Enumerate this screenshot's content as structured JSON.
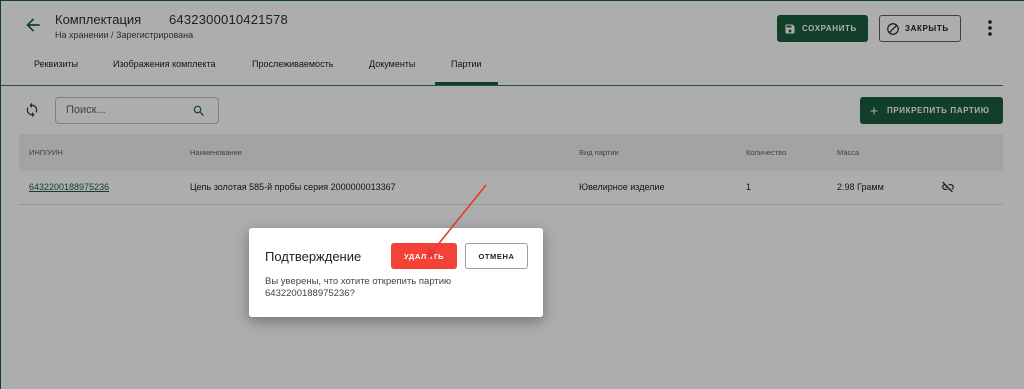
{
  "header": {
    "title": "Комплектация",
    "doc_number": "6432300010421578",
    "subtitle": "На хранении / Зарегистрирована",
    "save_label": "СОХРАНИТЬ",
    "close_label": "ЗАКРЫТЬ"
  },
  "tabs": [
    {
      "label": "Реквизиты"
    },
    {
      "label": "Изображения комплекта"
    },
    {
      "label": "Прослеживаемость"
    },
    {
      "label": "Документы"
    },
    {
      "label": "Партии",
      "active": true
    }
  ],
  "toolbar": {
    "search_placeholder": "Поиск...",
    "attach_label": "ПРИКРЕПИТЬ ПАРТИЮ"
  },
  "table": {
    "columns": [
      "ИНП/УИН",
      "Наименование",
      "Вид партии",
      "Количество",
      "Масса"
    ],
    "rows": [
      {
        "inp": "6432200188975236",
        "name": "Цепь золотая 585-й пробы серия 2000000013367",
        "kind": "Ювелирное изделие",
        "qty": "1",
        "mass": "2.98 Грамм"
      }
    ]
  },
  "dialog": {
    "title": "Подтверждение",
    "delete_label": "УДАЛИТЬ",
    "cancel_label": "ОТМЕНА",
    "text": "Вы уверены, что хотите открепить партию 6432200188975236?"
  },
  "colors": {
    "primary": "#1b5e3f",
    "danger": "#f44336",
    "annotation_arrow": "#e53935"
  }
}
